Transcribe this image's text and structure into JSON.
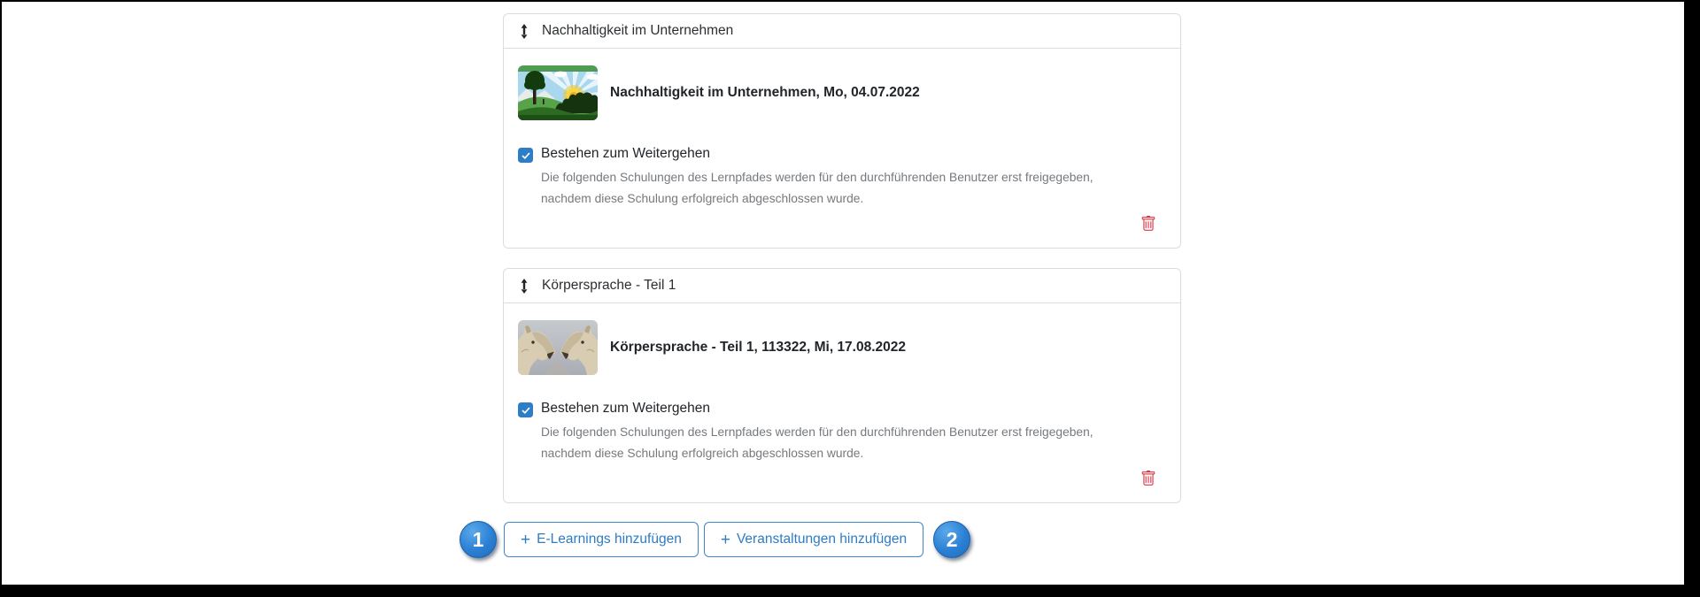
{
  "cards": [
    {
      "header": "Nachhaltigkeit im Unternehmen",
      "title": "Nachhaltigkeit im Unternehmen, Mo, 04.07.2022",
      "checkbox_label": "Bestehen zum Weitergehen",
      "checkbox_checked": true,
      "description": "Die folgenden Schulungen des Lernpfades werden für den durchführenden Benutzer erst freigegeben, nachdem diese Schulung erfolgreich abgeschlossen wurde.",
      "thumbnail": "landscape-sunburst-illustration"
    },
    {
      "header": "Körpersprache - Teil 1",
      "title": "Körpersprache - Teil 1, 113322, Mi, 17.08.2022",
      "checkbox_label": "Bestehen zum Weitergehen",
      "checkbox_checked": true,
      "description": "Die folgenden Schulungen des Lernpfades werden für den durchführenden Benutzer erst freigegeben, nachdem diese Schulung erfolgreich abgeschlossen wurde.",
      "thumbnail": "two-sheep-facing"
    }
  ],
  "buttons": {
    "add_elearnings": {
      "icon": "+",
      "label": "E-Learnings hinzufügen"
    },
    "add_events": {
      "icon": "+",
      "label": "Veranstaltungen hinzufügen"
    }
  },
  "annotations": {
    "step1": "1",
    "step2": "2"
  },
  "colors": {
    "accent_blue": "#2e7cc4",
    "checkbox_blue": "#2f7dc6",
    "badge_blue": "#2b80d4",
    "danger_red": "#dc3545",
    "border_gray": "#d9dce0",
    "text_dark": "#212529",
    "text_muted": "#75797e",
    "frame_black": "#000000"
  }
}
